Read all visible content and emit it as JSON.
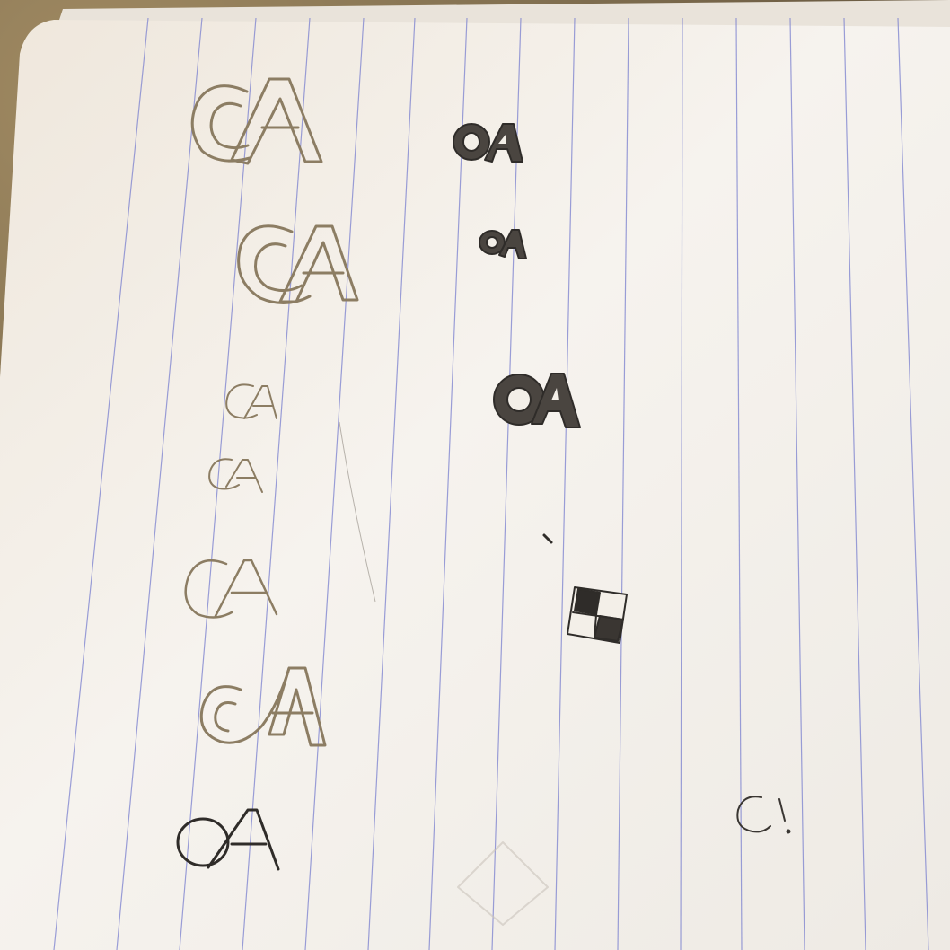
{
  "scene": {
    "subject": "lined-notebook-page-with-logo-sketches",
    "colors": {
      "paper": "#f3efe8",
      "paper_shadow": "#d9d2c7",
      "rule_line": "#6f77c9",
      "pencil": "#3a3632",
      "metallic_pen": "#8c7d63",
      "background": "#7a6a4f"
    },
    "sketches": [
      {
        "text": "CA",
        "style": "outlined-metallic"
      },
      {
        "text": "OA",
        "style": "filled-pencil"
      },
      {
        "text": "CA",
        "style": "outlined-metallic"
      },
      {
        "text": "OA",
        "style": "filled-pencil"
      },
      {
        "text": "CA",
        "style": "thin-metallic"
      },
      {
        "text": "OA",
        "style": "filled-pencil"
      },
      {
        "text": "CA",
        "style": "thin-metallic"
      },
      {
        "text": "CA",
        "style": "thin-metallic"
      },
      {
        "text": "",
        "style": "checker-square-pencil"
      },
      {
        "text": "CA",
        "style": "outlined-metallic"
      },
      {
        "text": "OA",
        "style": "dark-pencil"
      },
      {
        "text": "C!",
        "style": "thin-pencil"
      }
    ]
  }
}
